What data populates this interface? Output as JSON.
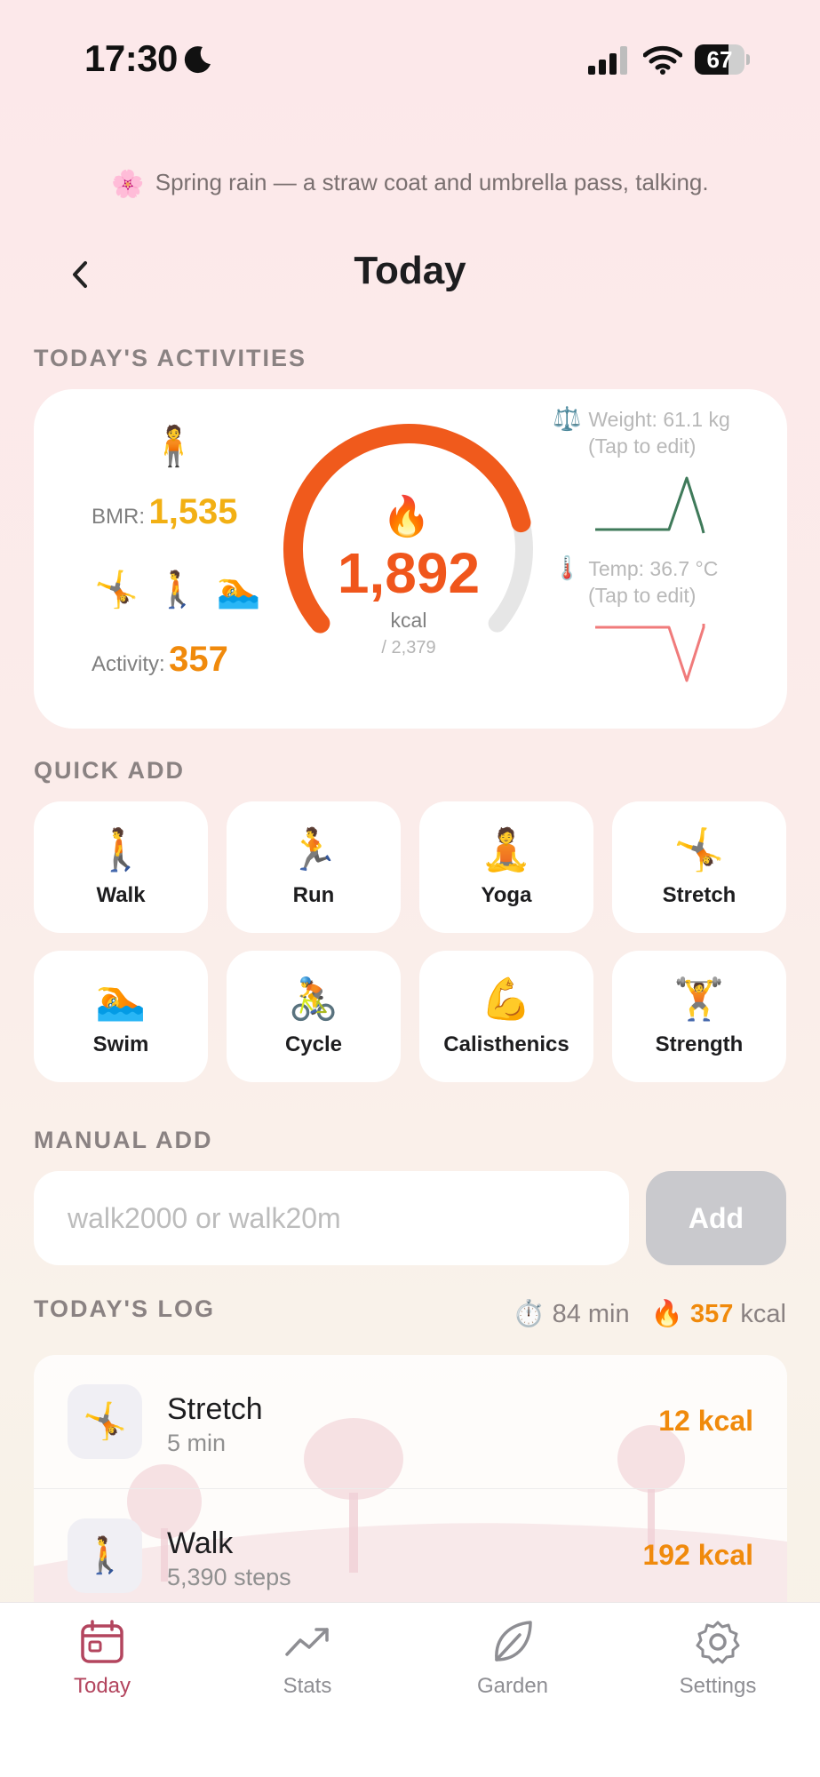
{
  "status_bar": {
    "time": "17:30",
    "battery": "67",
    "battery_level": 0.67,
    "icons": [
      "moon-icon",
      "cellular-signal-icon",
      "wifi-icon",
      "battery-icon"
    ]
  },
  "haiku": {
    "icon": "🌸",
    "text": "Spring rain — a straw coat and umbrella pass, talking."
  },
  "header": {
    "title": "Today",
    "back_icon": "chevron-left-icon"
  },
  "activities": {
    "section_label": "TODAY'S ACTIVITIES",
    "bmr_emoji": "🧍",
    "bmr_label": "BMR:",
    "bmr_value": "1,535",
    "activity_emojis": "🤸 🚶 🏊",
    "activity_label": "Activity:",
    "activity_value": "357",
    "gauge": {
      "fire_emoji": "🔥",
      "value": "1,892",
      "unit": "kcal",
      "goal": "/ 2,379",
      "progress": 0.795,
      "accent": "#f05a1c",
      "track": "#e6e6e6"
    },
    "weight": {
      "icon": "⚖️",
      "line1": "Weight: 61.1 kg",
      "line2": "(Tap to edit)",
      "color": "#3f7a5a"
    },
    "temp": {
      "icon": "🌡️",
      "line1": "Temp: 36.7 °C",
      "line2": "(Tap to edit)",
      "color": "#f07b7b"
    }
  },
  "quick_add": {
    "section_label": "QUICK ADD",
    "items": [
      {
        "emoji": "🚶",
        "label": "Walk"
      },
      {
        "emoji": "🏃",
        "label": "Run"
      },
      {
        "emoji": "🧘",
        "label": "Yoga"
      },
      {
        "emoji": "🤸",
        "label": "Stretch"
      },
      {
        "emoji": "🏊",
        "label": "Swim"
      },
      {
        "emoji": "🚴",
        "label": "Cycle"
      },
      {
        "emoji": "💪",
        "label": "Calisthenics"
      },
      {
        "emoji": "🏋️",
        "label": "Strength"
      }
    ]
  },
  "manual_add": {
    "section_label": "MANUAL ADD",
    "placeholder": "walk2000 or walk20m",
    "button_label": "Add"
  },
  "log": {
    "section_label": "TODAY'S LOG",
    "timer_icon": "⏱️",
    "total_minutes": "84 min",
    "fire_icon": "🔥",
    "total_kcal": "357",
    "kcal_unit": "kcal",
    "entries": [
      {
        "emoji": "🤸",
        "name": "Stretch",
        "detail": "5 min",
        "kcal": "12 kcal"
      },
      {
        "emoji": "🚶",
        "name": "Walk",
        "detail": "5,390 steps",
        "kcal": "192 kcal"
      }
    ]
  },
  "tab_bar": {
    "active_color": "#b3455e",
    "tabs": [
      {
        "label": "Today",
        "icon": "calendar-icon"
      },
      {
        "label": "Stats",
        "icon": "trend-chart-icon"
      },
      {
        "label": "Garden",
        "icon": "leaf-icon"
      },
      {
        "label": "Settings",
        "icon": "gear-icon"
      }
    ]
  }
}
